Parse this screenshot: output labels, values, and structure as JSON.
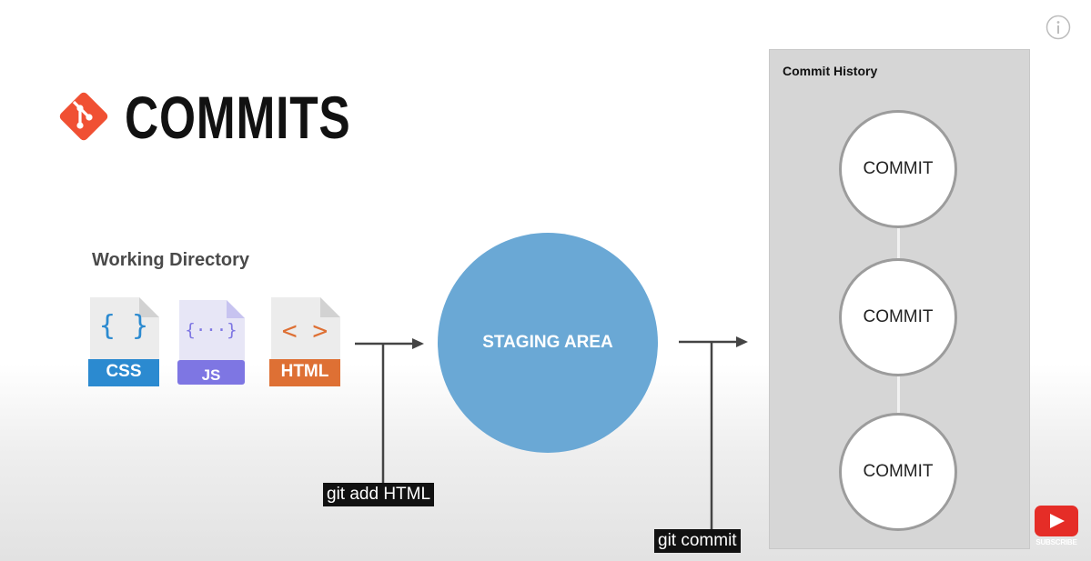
{
  "header": {
    "title": "COMMITS",
    "logo_icon": "git-logo-icon",
    "accent_color": "#f05033"
  },
  "working_directory": {
    "label": "Working Directory",
    "files": [
      {
        "label": "CSS",
        "glyph": "{ }",
        "icon": "css-file-icon",
        "color": "#2b8ad0"
      },
      {
        "label": "JS",
        "glyph": "{···}",
        "icon": "js-file-icon",
        "color": "#7e76e3"
      },
      {
        "label": "HTML",
        "glyph": "< >",
        "icon": "html-file-icon",
        "color": "#de7034"
      }
    ]
  },
  "staging": {
    "label": "STAGING AREA",
    "color": "#6aa8d5"
  },
  "captions": {
    "git_add": "git add HTML",
    "git_commit": "git commit"
  },
  "history": {
    "title": "Commit History",
    "commits": [
      {
        "label": "COMMIT"
      },
      {
        "label": "COMMIT"
      },
      {
        "label": "COMMIT"
      }
    ]
  },
  "subscribe": {
    "label": "SUBSCRIBE",
    "color": "#e52d27"
  }
}
